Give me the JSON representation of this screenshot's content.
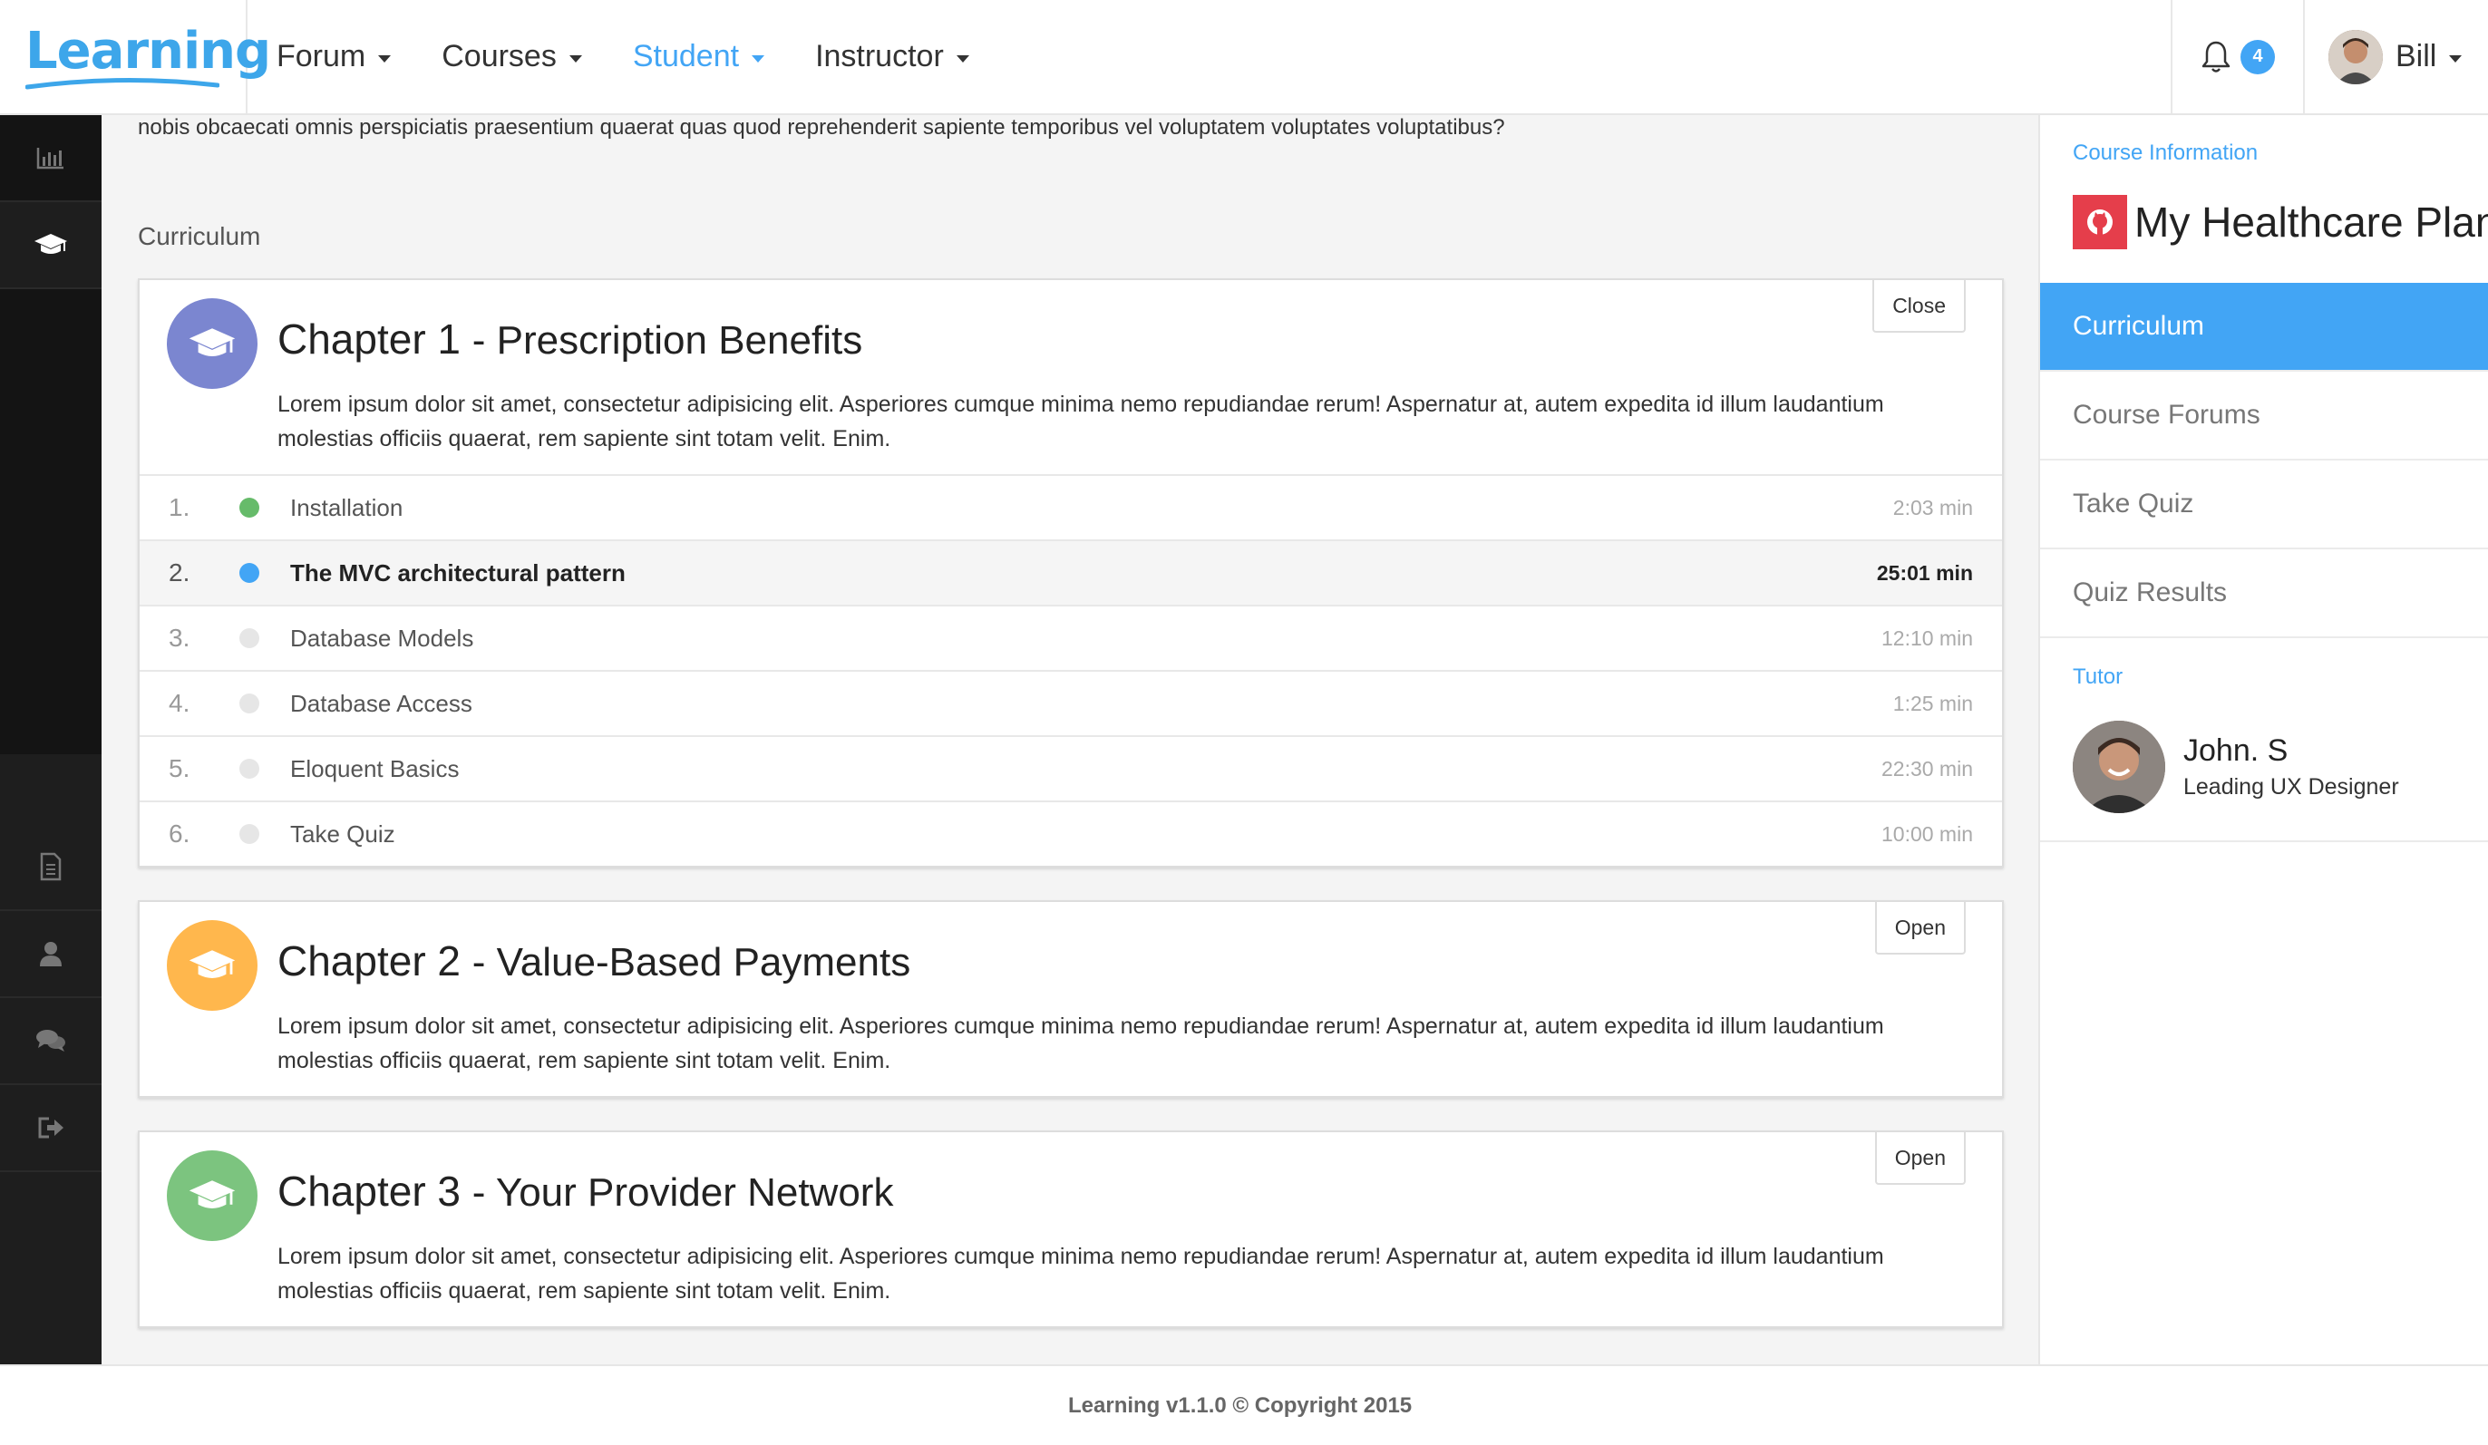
{
  "brand": {
    "name": "Learning",
    "color": "#3da6ea"
  },
  "nav": {
    "items": [
      {
        "label": "Forum",
        "active": false
      },
      {
        "label": "Courses",
        "active": false
      },
      {
        "label": "Student",
        "active": true
      },
      {
        "label": "Instructor",
        "active": false
      }
    ],
    "notifications_count": "4",
    "user_name": "Bill"
  },
  "sidebar": {
    "icons": [
      "bar-chart-icon",
      "graduation-cap-icon",
      "document-icon",
      "user-icon",
      "comments-icon",
      "sign-out-icon"
    ]
  },
  "main": {
    "intro_text": "nobis obcaecati omnis perspiciatis praesentium quaerat quas quod reprehenderit sapiente temporibus vel voluptatem voluptates voluptatibus?",
    "section_label": "Curriculum",
    "chapters": [
      {
        "number": "Chapter 1",
        "title": "- Prescription Benefits",
        "description": "Lorem ipsum dolor sit amet, consectetur adipisicing elit. Asperiores cumque minima nemo repudiandae rerum! Aspernatur at, autem expedita id illum laudantium molestias officiis quaerat, rem sapiente sint totam velit. Enim.",
        "toggle": "Close",
        "color": "#7b86d0",
        "lessons": [
          {
            "num": "1.",
            "name": "Installation",
            "time": "2:03 min",
            "status_color": "#66bb6a"
          },
          {
            "num": "2.",
            "name": "The MVC architectural pattern",
            "time": "25:01 min",
            "status_color": "#42a5f5"
          },
          {
            "num": "3.",
            "name": "Database Models",
            "time": "12:10 min",
            "status_color": "#e6e6e6"
          },
          {
            "num": "4.",
            "name": "Database Access",
            "time": "1:25 min",
            "status_color": "#e6e6e6"
          },
          {
            "num": "5.",
            "name": "Eloquent Basics",
            "time": "22:30 min",
            "status_color": "#e6e6e6"
          },
          {
            "num": "6.",
            "name": "Take Quiz",
            "time": "10:00 min",
            "status_color": "#e6e6e6"
          }
        ]
      },
      {
        "number": "Chapter 2",
        "title": "- Value-Based Payments",
        "description": "Lorem ipsum dolor sit amet, consectetur adipisicing elit. Asperiores cumque minima nemo repudiandae rerum! Aspernatur at, autem expedita id illum laudantium molestias officiis quaerat, rem sapiente sint totam velit. Enim.",
        "toggle": "Open",
        "color": "#ffb74d"
      },
      {
        "number": "Chapter 3",
        "title": "- Your Provider Network",
        "description": "Lorem ipsum dolor sit amet, consectetur adipisicing elit. Asperiores cumque minima nemo repudiandae rerum! Aspernatur at, autem expedita id illum laudantium molestias officiis quaerat, rem sapiente sint totam velit. Enim.",
        "toggle": "Open",
        "color": "#7cc47f"
      }
    ]
  },
  "right_panel": {
    "course_info_label": "Course Information",
    "course_title": "My Healthcare Plan",
    "menu": [
      {
        "label": "Curriculum",
        "active": true
      },
      {
        "label": "Course Forums",
        "active": false
      },
      {
        "label": "Take Quiz",
        "active": false
      },
      {
        "label": "Quiz Results",
        "active": false
      }
    ],
    "tutor_label": "Tutor",
    "tutor_name": "John. S",
    "tutor_role": "Leading UX Designer"
  },
  "footer": {
    "text": "Learning v1.1.0 © Copyright 2015"
  }
}
